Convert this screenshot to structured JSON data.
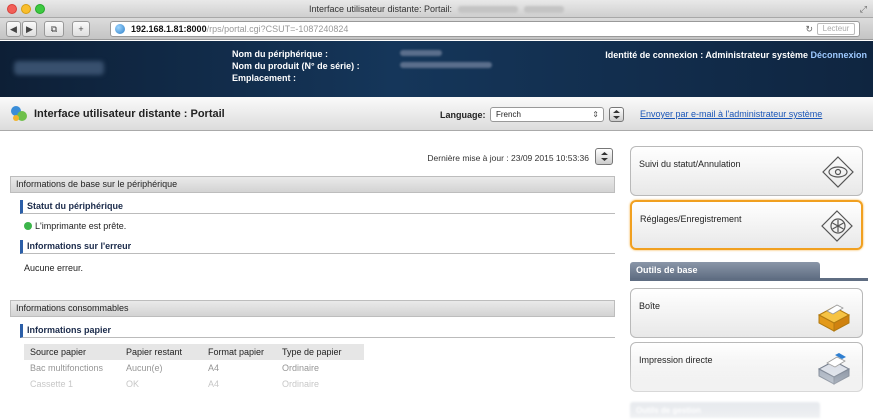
{
  "window": {
    "title": "Interface utilisateur distante: Portail:"
  },
  "browser": {
    "url_host": "192.168.1.81:8000",
    "url_path": "/rps/portal.cgi?CSUT=-1087240824",
    "reader_label": "Lecteur"
  },
  "header": {
    "device_name_label": "Nom du périphérique :",
    "product_name_label": "Nom du produit (N° de série) :",
    "location_label": "Emplacement :",
    "login_text": "Identité de connexion : Administrateur système",
    "logout_label": "Déconnexion"
  },
  "portal": {
    "title": "Interface utilisateur distante : Portail",
    "language_label": "Language:",
    "language_value": "French",
    "mail_link": "Envoyer par e-mail à l'administrateur système"
  },
  "main": {
    "last_update": "Dernière mise à jour : 23/09 2015 10:53:36",
    "basic_info_header": "Informations de base sur le périphérique",
    "device_status_header": "Statut du périphérique",
    "device_status_text": "L'imprimante est prête.",
    "error_info_header": "Informations sur l'erreur",
    "error_text": "Aucune erreur.",
    "consumables_header": "Informations consommables",
    "paper_info_header": "Informations papier",
    "paper_table": {
      "columns": [
        "Source papier",
        "Papier restant",
        "Format papier",
        "Type de papier"
      ],
      "rows": [
        [
          "Bac multifonctions",
          "Aucun(e)",
          "A4",
          "Ordinaire"
        ],
        [
          "Cassette 1",
          "OK",
          "A4",
          "Ordinaire"
        ]
      ]
    }
  },
  "sidebar": {
    "status_cancel": "Suivi du statut/Annulation",
    "settings_registration": "Réglages/Enregistrement",
    "basic_tools_header": "Outils de base",
    "mailbox": "Boîte",
    "direct_print": "Impression directe",
    "management_tools_header": "Outils de gestion"
  },
  "colors": {
    "header_bg": "#15365a",
    "highlight": "#f1a020",
    "link": "#1a56b8",
    "status_ok": "#3cb54a"
  }
}
